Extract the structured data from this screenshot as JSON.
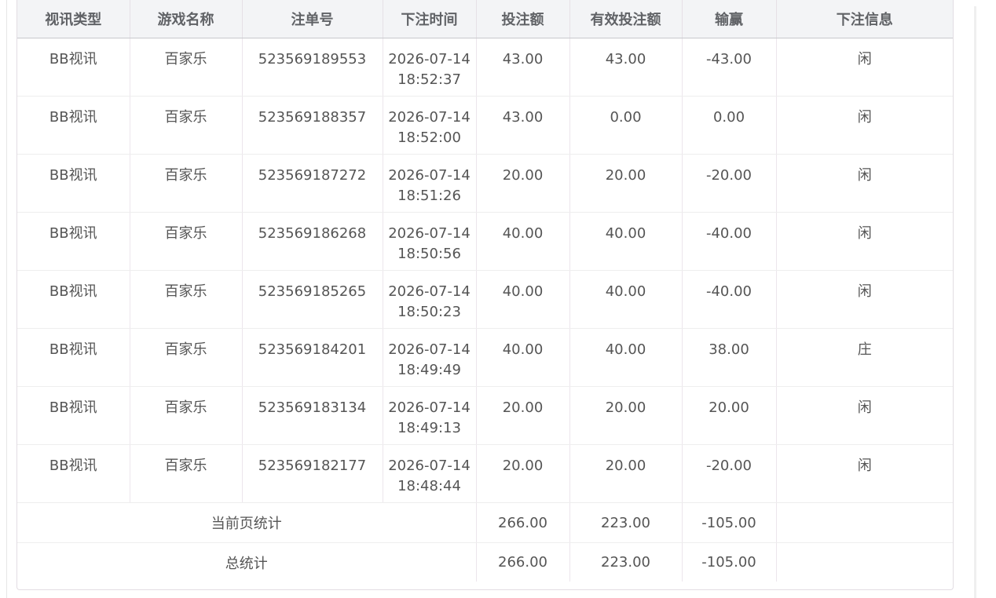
{
  "table": {
    "columns": [
      "视讯类型",
      "游戏名称",
      "注单号",
      "下注时间",
      "投注额",
      "有效投注额",
      "输赢",
      "下注信息"
    ],
    "rows": [
      {
        "type": "BB视讯",
        "game": "百家乐",
        "bet_id": "523569189553",
        "date": "2026-07-14",
        "time": "18:52:37",
        "amount": "43.00",
        "valid": "43.00",
        "win_loss": "-43.00",
        "info": "闲"
      },
      {
        "type": "BB视讯",
        "game": "百家乐",
        "bet_id": "523569188357",
        "date": "2026-07-14",
        "time": "18:52:00",
        "amount": "43.00",
        "valid": "0.00",
        "win_loss": "0.00",
        "info": "闲"
      },
      {
        "type": "BB视讯",
        "game": "百家乐",
        "bet_id": "523569187272",
        "date": "2026-07-14",
        "time": "18:51:26",
        "amount": "20.00",
        "valid": "20.00",
        "win_loss": "-20.00",
        "info": "闲"
      },
      {
        "type": "BB视讯",
        "game": "百家乐",
        "bet_id": "523569186268",
        "date": "2026-07-14",
        "time": "18:50:56",
        "amount": "40.00",
        "valid": "40.00",
        "win_loss": "-40.00",
        "info": "闲"
      },
      {
        "type": "BB视讯",
        "game": "百家乐",
        "bet_id": "523569185265",
        "date": "2026-07-14",
        "time": "18:50:23",
        "amount": "40.00",
        "valid": "40.00",
        "win_loss": "-40.00",
        "info": "闲"
      },
      {
        "type": "BB视讯",
        "game": "百家乐",
        "bet_id": "523569184201",
        "date": "2026-07-14",
        "time": "18:49:49",
        "amount": "40.00",
        "valid": "40.00",
        "win_loss": "38.00",
        "info": "庄"
      },
      {
        "type": "BB视讯",
        "game": "百家乐",
        "bet_id": "523569183134",
        "date": "2026-07-14",
        "time": "18:49:13",
        "amount": "20.00",
        "valid": "20.00",
        "win_loss": "20.00",
        "info": "闲"
      },
      {
        "type": "BB视讯",
        "game": "百家乐",
        "bet_id": "523569182177",
        "date": "2026-07-14",
        "time": "18:48:44",
        "amount": "20.00",
        "valid": "20.00",
        "win_loss": "-20.00",
        "info": "闲"
      }
    ],
    "page_summary": {
      "label": "当前页统计",
      "amount": "266.00",
      "valid": "223.00",
      "win_loss": "-105.00"
    },
    "total_summary": {
      "label": "总统计",
      "amount": "266.00",
      "valid": "223.00",
      "win_loss": "-105.00"
    }
  }
}
